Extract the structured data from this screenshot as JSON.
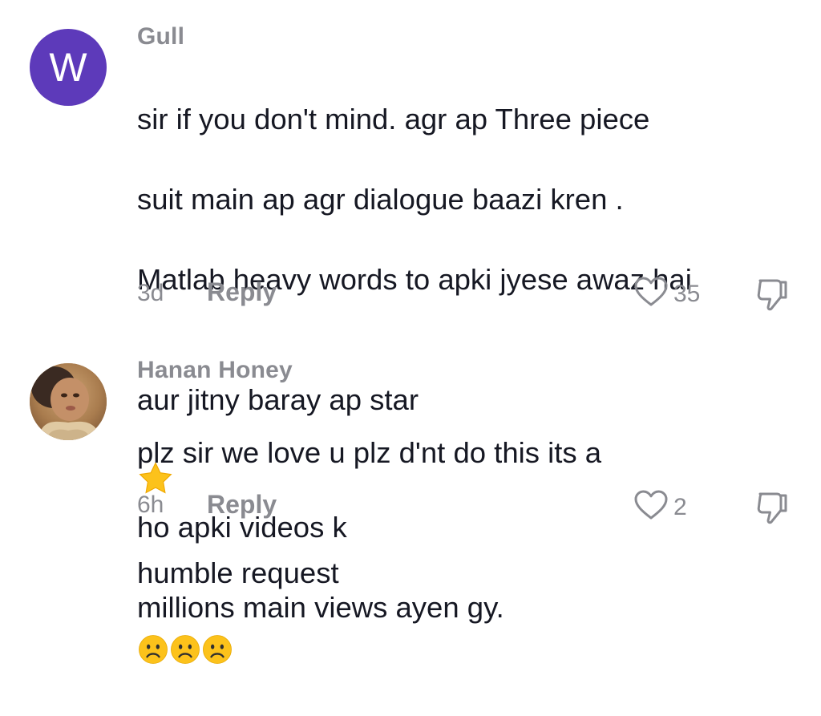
{
  "comments": [
    {
      "avatar_letter": "W",
      "avatar_color": "#5d3aba",
      "username": "Gull",
      "text_lines": [
        "sir if you don't mind. agr ap Three piece",
        "suit main ap agr dialogue baazi kren .",
        "Matlab heavy words to apki jyese awaz hai",
        "aur jitny baray ap star",
        "ho apki videos k",
        "millions main views ayen gy."
      ],
      "emoji": "star",
      "time": "3d",
      "reply_label": "Reply",
      "likes": "35",
      "like_icon": "heart-outline-icon",
      "dislike_icon": "thumbs-down-icon"
    },
    {
      "avatar_letter": "",
      "username": "Hanan Honey",
      "text_lines": [
        "plz sir we love u plz d'nt do this its a",
        "humble request"
      ],
      "emoji": "frowning-face x3",
      "time": "6h",
      "reply_label": "Reply",
      "likes": "2",
      "like_icon": "heart-outline-icon",
      "dislike_icon": "thumbs-down-icon"
    }
  ],
  "colors": {
    "text_primary": "#161823",
    "text_secondary": "#8a8b91",
    "star_emoji": "#fcc21b",
    "frown_emoji": "#fcc21b"
  }
}
